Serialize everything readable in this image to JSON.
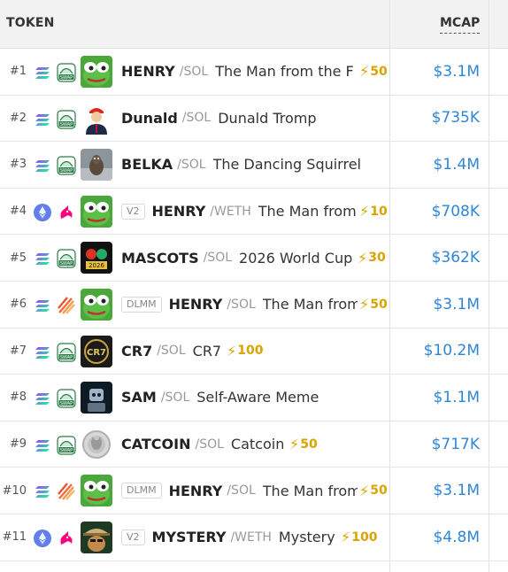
{
  "header": {
    "token_label": "TOKEN",
    "mcap_label": "MCAP"
  },
  "colors": {
    "accent": "#2e86d6",
    "boost": "#d9a400"
  },
  "rows": [
    {
      "rank": "#1",
      "chain": "solana-icon",
      "dex": "swap-icon",
      "avatar": "pepe-icon",
      "tag": "",
      "symbol": "HENRY",
      "quote": "/SOL",
      "name": "The Man from the F",
      "boost": "50",
      "mcap": "$3.1M"
    },
    {
      "rank": "#2",
      "chain": "solana-icon",
      "dex": "swap-icon",
      "avatar": "person-icon",
      "tag": "",
      "symbol": "Dunald",
      "quote": "/SOL",
      "name": "Dunald Tromp",
      "boost": "",
      "mcap": "$735K"
    },
    {
      "rank": "#3",
      "chain": "solana-icon",
      "dex": "swap-icon",
      "avatar": "squirrel-icon",
      "tag": "",
      "symbol": "BELKA",
      "quote": "/SOL",
      "name": "The Dancing Squirrel",
      "boost": "",
      "mcap": "$1.4M"
    },
    {
      "rank": "#4",
      "chain": "ethereum-icon",
      "dex": "unicorn-icon",
      "avatar": "pepe-icon",
      "tag": "V2",
      "symbol": "HENRY",
      "quote": "/WETH",
      "name": "The Man from",
      "boost": "10",
      "mcap": "$708K"
    },
    {
      "rank": "#5",
      "chain": "solana-icon",
      "dex": "swap-icon",
      "avatar": "mascots-icon",
      "tag": "",
      "symbol": "MASCOTS",
      "quote": "/SOL",
      "name": "2026 World Cup",
      "boost": "30",
      "mcap": "$362K"
    },
    {
      "rank": "#6",
      "chain": "solana-icon",
      "dex": "stripes-icon",
      "avatar": "pepe-icon",
      "tag": "DLMM",
      "symbol": "HENRY",
      "quote": "/SOL",
      "name": "The Man from",
      "boost": "50",
      "mcap": "$3.1M"
    },
    {
      "rank": "#7",
      "chain": "solana-icon",
      "dex": "swap-icon",
      "avatar": "cr7-icon",
      "tag": "",
      "symbol": "CR7",
      "quote": "/SOL",
      "name": "CR7",
      "boost": "100",
      "mcap": "$10.2M"
    },
    {
      "rank": "#8",
      "chain": "solana-icon",
      "dex": "swap-icon",
      "avatar": "robot-icon",
      "tag": "",
      "symbol": "SAM",
      "quote": "/SOL",
      "name": "Self-Aware Meme",
      "boost": "",
      "mcap": "$1.1M"
    },
    {
      "rank": "#9",
      "chain": "solana-icon",
      "dex": "swap-icon",
      "avatar": "coin-icon",
      "tag": "",
      "symbol": "CATCOIN",
      "quote": "/SOL",
      "name": "Catcoin",
      "boost": "50",
      "mcap": "$717K"
    },
    {
      "rank": "#10",
      "chain": "solana-icon",
      "dex": "stripes-icon",
      "avatar": "pepe-icon",
      "tag": "DLMM",
      "symbol": "HENRY",
      "quote": "/SOL",
      "name": "The Man from",
      "boost": "50",
      "mcap": "$3.1M"
    },
    {
      "rank": "#11",
      "chain": "ethereum-icon",
      "dex": "unicorn-icon",
      "avatar": "dog-hat-icon",
      "tag": "V2",
      "symbol": "MYSTERY",
      "quote": "/WETH",
      "name": "Mystery",
      "boost": "100",
      "mcap": "$4.8M"
    }
  ]
}
